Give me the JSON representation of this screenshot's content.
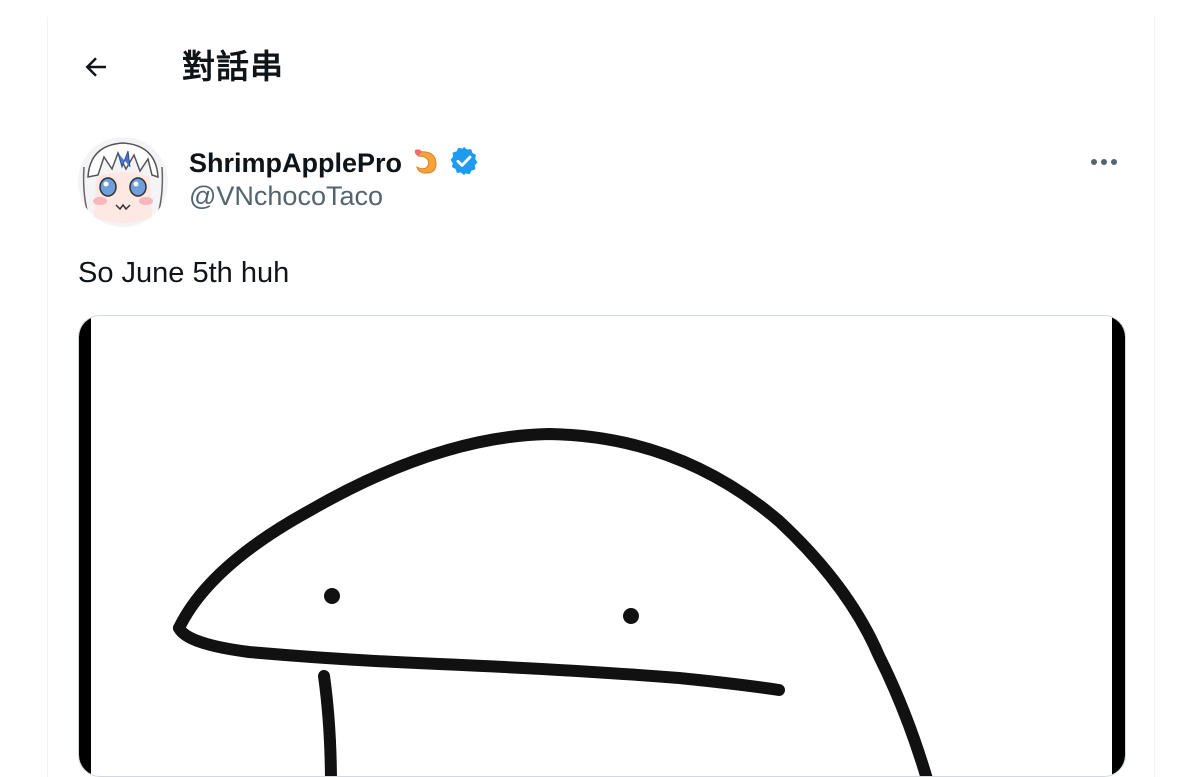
{
  "header": {
    "title": "對話串",
    "back_icon": "arrow-left-icon"
  },
  "tweet": {
    "author": {
      "display_name": "ShrimpApplePro",
      "emoji_icon": "shrimp-icon",
      "verified_icon": "verified-badge-icon",
      "handle": "@VNchocoTaco",
      "avatar": "anime-avatar"
    },
    "more_icon": "more-horizontal-icon",
    "text": "So June 5th huh",
    "media": {
      "type": "image",
      "description_icon": "blob-meme-drawing"
    }
  },
  "colors": {
    "text_primary": "#0f1419",
    "text_secondary": "#536471",
    "verified_blue": "#1d9bf0",
    "border": "#cfd9de",
    "shrimp": "#f5a33a"
  }
}
